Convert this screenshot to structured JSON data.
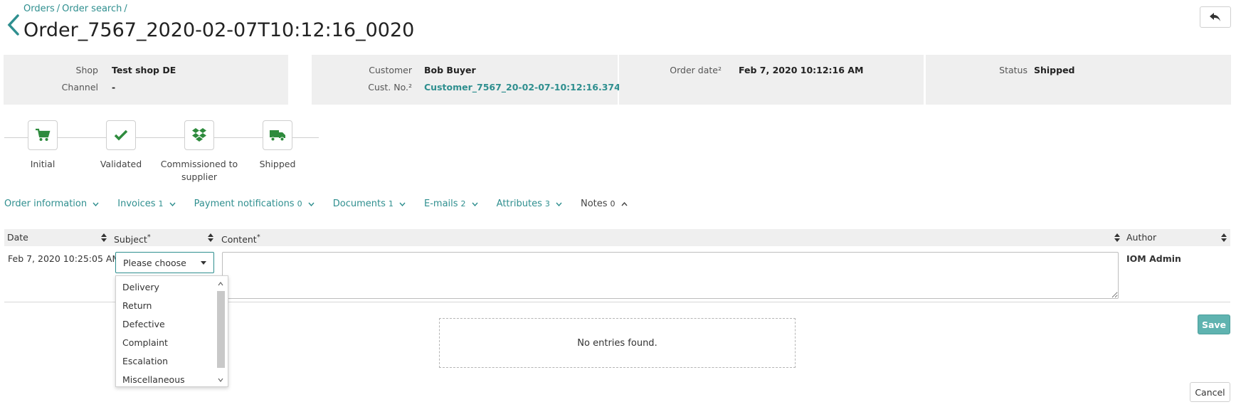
{
  "colors": {
    "accent": "#2f8f8f",
    "success": "#2e8b3d",
    "panel": "#efefef",
    "save": "#5fb3b0"
  },
  "breadcrumb": {
    "orders": "Orders",
    "order_search": "Order search",
    "sep": "/"
  },
  "page_title": "Order_7567_2020-02-07T10:12:16_0020",
  "info": {
    "shop_label": "Shop",
    "shop_value": "Test shop DE",
    "channel_label": "Channel",
    "channel_value": "-",
    "customer_label": "Customer",
    "customer_value": "Bob Buyer",
    "custno_label": "Cust. No.²",
    "custno_value": "Customer_7567_20-02-07-10:12:16.374",
    "orderdate_label": "Order date²",
    "orderdate_value": "Feb 7, 2020 10:12:16 AM",
    "status_label": "Status",
    "status_value": "Shipped"
  },
  "steps": [
    {
      "label": "Initial",
      "icon": "cart-icon"
    },
    {
      "label": "Validated",
      "icon": "check-icon"
    },
    {
      "label_line1": "Commissioned to",
      "label_line2": "supplier",
      "icon": "dropbox-icon"
    },
    {
      "label": "Shipped",
      "icon": "truck-icon"
    }
  ],
  "tabs": [
    {
      "label": "Order information",
      "count": ""
    },
    {
      "label": "Invoices",
      "count": "1"
    },
    {
      "label": "Payment notifications",
      "count": "0"
    },
    {
      "label": "Documents",
      "count": "1"
    },
    {
      "label": "E-mails",
      "count": "2"
    },
    {
      "label": "Attributes",
      "count": "3"
    },
    {
      "label": "Notes",
      "count": "0"
    }
  ],
  "table": {
    "col_date": "Date",
    "col_subject": "Subject",
    "col_content": "Content",
    "col_author": "Author",
    "required_mark": "*",
    "row_date": "Feb 7, 2020 10:25:05 AM",
    "row_author": "IOM Admin"
  },
  "subject_select": {
    "value": "Please choose",
    "options": [
      "Delivery",
      "Return",
      "Defective",
      "Complaint",
      "Escalation",
      "Miscellaneous"
    ]
  },
  "empty_message": "No entries found.",
  "buttons": {
    "save": "Save",
    "cancel": "Cancel"
  }
}
